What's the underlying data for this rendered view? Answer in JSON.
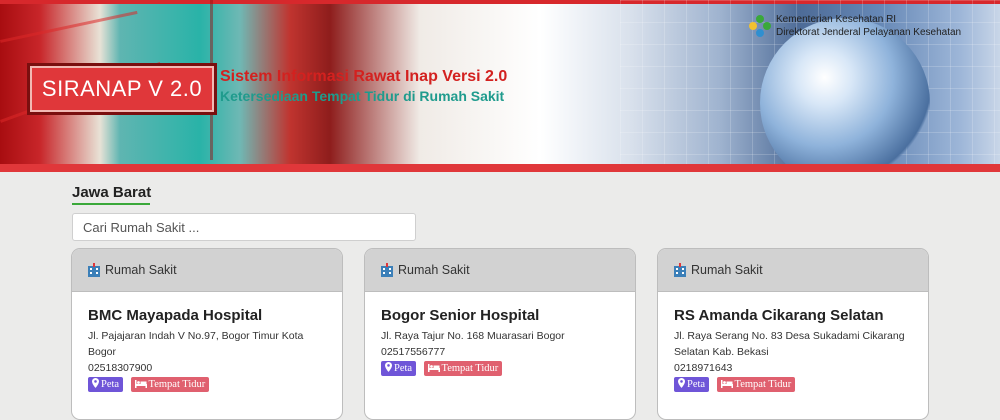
{
  "banner": {
    "badge_title": "SIRANAP V 2.0",
    "main_title": "Sistem Informasi Rawat Inap Versi 2.0",
    "subtitle": "Ketersediaan Tempat Tidur di Rumah Sakit",
    "ministry_line1": "Kementerian Kesehatan RI",
    "ministry_line2": "Direktorat Jenderal Pelayanan Kesehatan",
    "colors": {
      "red": "#e0373a",
      "teal": "#1f9b8d"
    }
  },
  "region": {
    "title": "Jawa Barat"
  },
  "search": {
    "placeholder": "Cari Rumah Sakit ..."
  },
  "cards": [
    {
      "header": "Rumah Sakit",
      "name": "BMC Mayapada Hospital",
      "address": "Jl. Pajajaran Indah V No.97, Bogor Timur Kota Bogor",
      "phone": "02518307900",
      "map_label": "Peta",
      "beds_label": "Tempat Tidur"
    },
    {
      "header": "Rumah Sakit",
      "name": "Bogor Senior Hospital",
      "address": "Jl. Raya Tajur No. 168 Muarasari Bogor",
      "phone": "02517556777",
      "map_label": "Peta",
      "beds_label": "Tempat Tidur"
    },
    {
      "header": "Rumah Sakit",
      "name": "RS Amanda Cikarang Selatan",
      "address": "Jl. Raya Serang No. 83 Desa Sukadami Cikarang Selatan Kab. Bekasi",
      "phone": "0218971643",
      "map_label": "Peta",
      "beds_label": "Tempat Tidur"
    }
  ],
  "icons": {
    "hospital": "hospital-icon",
    "map": "map-marker-icon",
    "bed": "bed-icon"
  },
  "badge_colors": {
    "peta": "#6f55d8",
    "tempat_tidur": "#e0606f"
  }
}
